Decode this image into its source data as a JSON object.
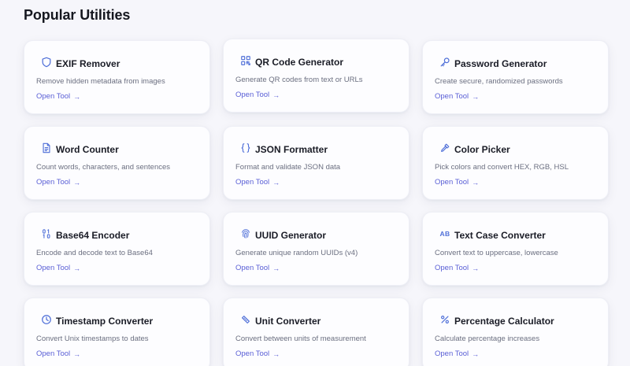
{
  "page": {
    "title": "Popular Utilities"
  },
  "accent_color": "#5a5fd6",
  "icon_color": "#4f6fd8",
  "link_arrow": "→",
  "tools": [
    {
      "title": "EXIF Remover",
      "description": "Remove hidden metadata from images",
      "link": "Open Tool",
      "icon": "shield-icon"
    },
    {
      "title": "QR Code Generator",
      "description": "Generate QR codes from text or URLs",
      "link": "Open Tool",
      "icon": "qr-code-icon"
    },
    {
      "title": "Password Generator",
      "description": "Create secure, randomized passwords",
      "link": "Open Tool",
      "icon": "key-icon"
    },
    {
      "title": "Word Counter",
      "description": "Count words, characters, and sentences",
      "link": "Open Tool",
      "icon": "document-icon"
    },
    {
      "title": "JSON Formatter",
      "description": "Format and validate JSON data",
      "link": "Open Tool",
      "icon": "braces-icon"
    },
    {
      "title": "Color Picker",
      "description": "Pick colors and convert HEX, RGB, HSL",
      "link": "Open Tool",
      "icon": "eyedropper-icon"
    },
    {
      "title": "Base64 Encoder",
      "description": "Encode and decode text to Base64",
      "link": "Open Tool",
      "icon": "binary-icon"
    },
    {
      "title": "UUID Generator",
      "description": "Generate unique random UUIDs (v4)",
      "link": "Open Tool",
      "icon": "fingerprint-icon"
    },
    {
      "title": "Text Case Converter",
      "description": "Convert text to uppercase, lowercase",
      "link": "Open Tool",
      "icon": "text-case-icon",
      "icon_text": "AB"
    },
    {
      "title": "Timestamp Converter",
      "description": "Convert Unix timestamps to dates",
      "link": "Open Tool",
      "icon": "clock-icon"
    },
    {
      "title": "Unit Converter",
      "description": "Convert between units of measurement",
      "link": "Open Tool",
      "icon": "ruler-icon"
    },
    {
      "title": "Percentage Calculator",
      "description": "Calculate percentage increases",
      "link": "Open Tool",
      "icon": "percent-icon"
    }
  ]
}
